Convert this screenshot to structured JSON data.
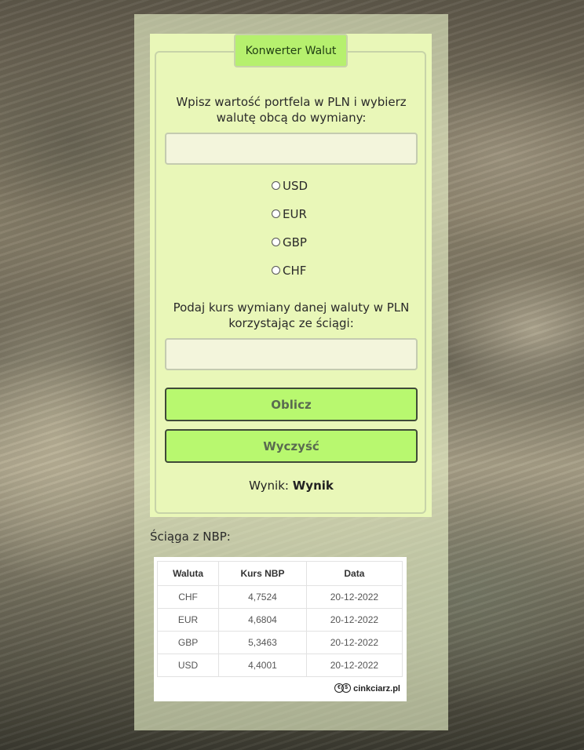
{
  "converter": {
    "legend": "Konwerter Walut",
    "instruction_amount": "Wpisz wartość portfela w PLN i wybierz walutę obcą do wymiany:",
    "amount_value": "",
    "currencies": [
      "USD",
      "EUR",
      "GBP",
      "CHF"
    ],
    "instruction_rate": "Podaj kurs wymiany danej waluty w PLN korzystając ze ściągi:",
    "rate_value": "",
    "calculate_label": "Oblicz",
    "clear_label": "Wyczyść",
    "result_label": "Wynik:",
    "result_value": "Wynik"
  },
  "cheatsheet": {
    "title": "Ściąga z NBP:",
    "headers": [
      "Waluta",
      "Kurs NBP",
      "Data"
    ],
    "rows": [
      [
        "CHF",
        "4,7524",
        "20-12-2022"
      ],
      [
        "EUR",
        "4,6804",
        "20-12-2022"
      ],
      [
        "GBP",
        "5,3463",
        "20-12-2022"
      ],
      [
        "USD",
        "4,4001",
        "20-12-2022"
      ]
    ],
    "brand": "cinkciarz.pl"
  }
}
